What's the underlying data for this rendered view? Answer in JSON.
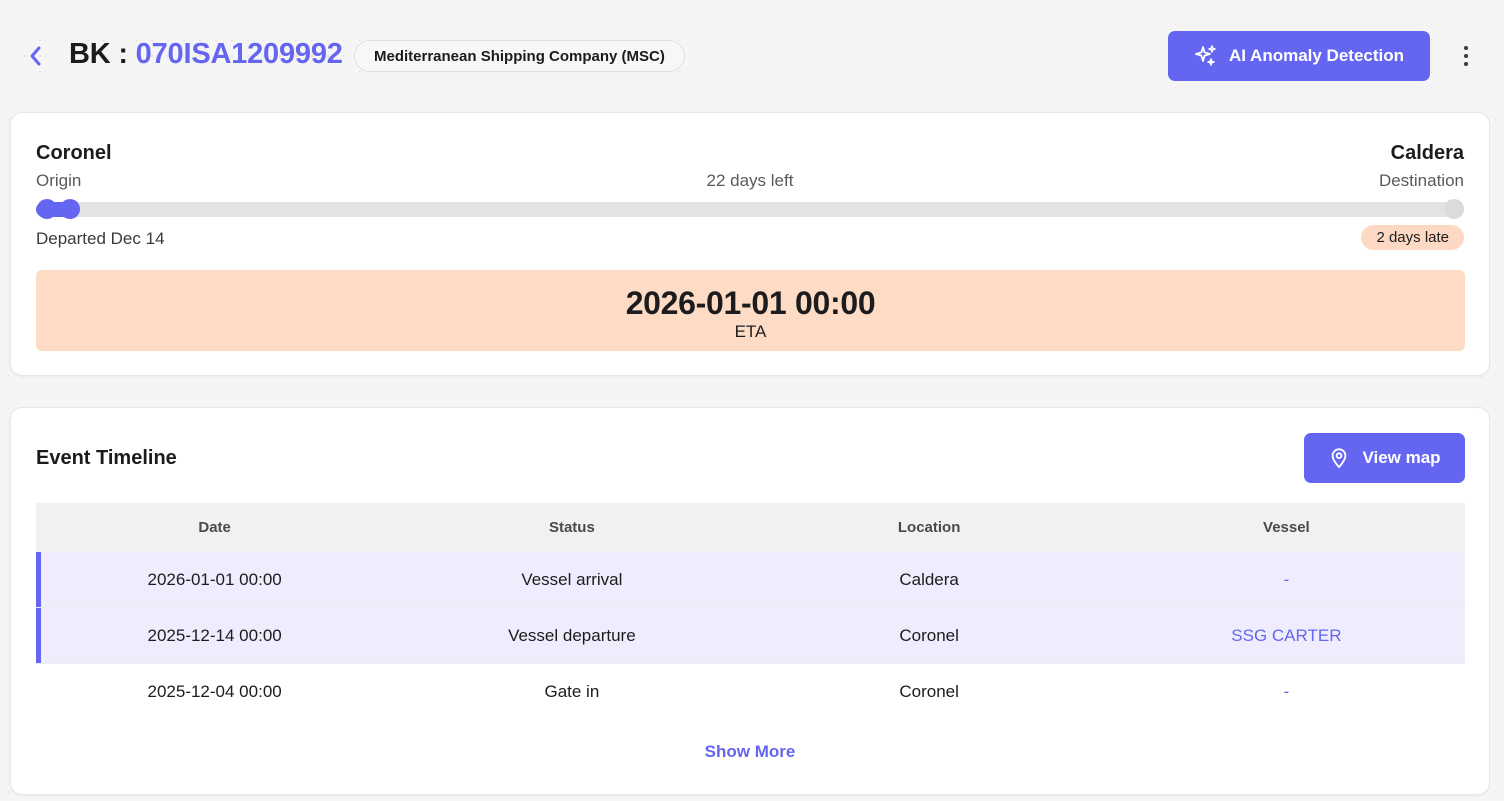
{
  "header": {
    "bk_prefix": "BK : ",
    "booking_id": "070ISA1209992",
    "carrier": "Mediterranean Shipping Company (MSC)",
    "ai_button_label": "AI Anomaly Detection"
  },
  "route": {
    "origin_name": "Coronel",
    "origin_label": "Origin",
    "destination_name": "Caldera",
    "destination_label": "Destination",
    "days_left": "22 days left",
    "departed": "Departed Dec 14",
    "late_badge": "2 days late",
    "eta_value": "2026-01-01 00:00",
    "eta_label": "ETA",
    "progress_fraction": 0.03
  },
  "events": {
    "title": "Event Timeline",
    "map_button_label": "View map",
    "columns": [
      "Date",
      "Status",
      "Location",
      "Vessel"
    ],
    "rows": [
      {
        "date": "2026-01-01 00:00",
        "status": "Vessel arrival",
        "location": "Caldera",
        "vessel": "-"
      },
      {
        "date": "2025-12-14 00:00",
        "status": "Vessel departure",
        "location": "Coronel",
        "vessel": "SSG CARTER"
      },
      {
        "date": "2025-12-04 00:00",
        "status": "Gate in",
        "location": "Coronel",
        "vessel": "-"
      }
    ],
    "show_more_label": "Show More"
  },
  "colors": {
    "accent": "#6466f1",
    "eta_background": "#fddbc4",
    "late_badge": "#fdd8c3",
    "highlight_row": "#efedfd"
  },
  "icons": {
    "back": "chevron-left-icon",
    "ai": "sparkles-icon",
    "more": "vertical-dots-icon",
    "map": "map-pin-icon"
  }
}
